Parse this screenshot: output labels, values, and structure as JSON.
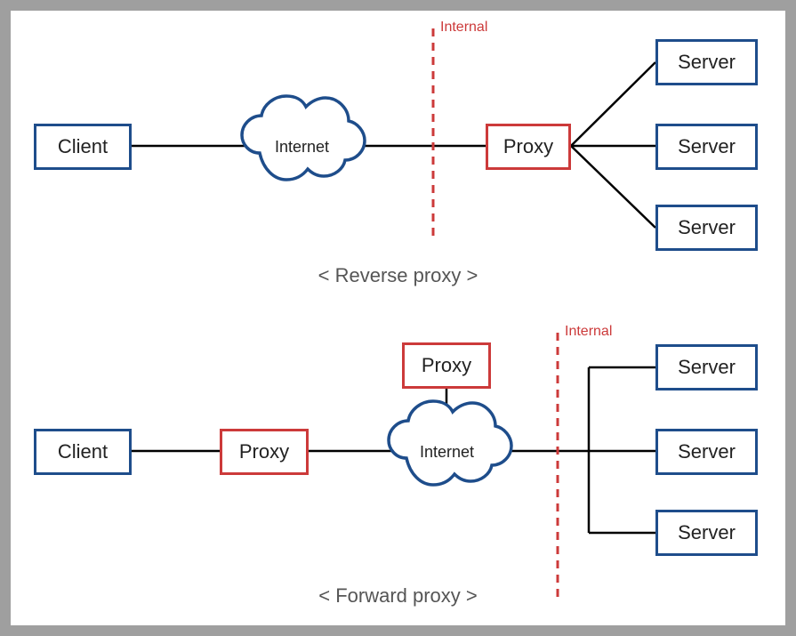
{
  "labels": {
    "client": "Client",
    "internet": "Internet",
    "proxy": "Proxy",
    "server": "Server",
    "internal": "Internal"
  },
  "captions": {
    "reverse": "< Reverse proxy >",
    "forward": "< Forward proxy >"
  },
  "diagram": {
    "top": {
      "title": "Reverse proxy",
      "flow": "Client → Internet → (internal boundary) → Proxy → [Server, Server, Server]",
      "internal_side": "right-of-proxy"
    },
    "bottom": {
      "title": "Forward proxy",
      "flow": "Client → Proxy → Internet (with Proxy above) → (internal boundary) → [Server, Server, Server]",
      "internal_side": "right-of-internet"
    }
  }
}
